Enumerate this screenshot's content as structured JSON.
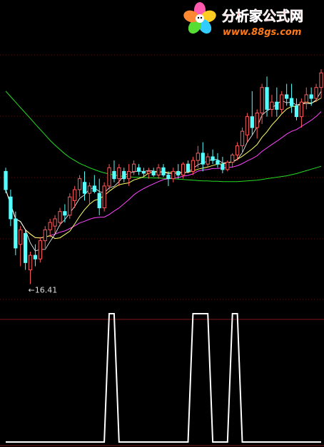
{
  "watermark": {
    "title": "分析家公式网",
    "url": "www.88gs.com",
    "colors": {
      "title": "#ff2a2a",
      "url": "#ff7a1a"
    }
  },
  "chart_data": [
    {
      "type": "candlestick",
      "ylim": [
        15.6,
        22.4
      ],
      "grid": true,
      "low_annotation": {
        "label": "←16.41",
        "value": 16.41,
        "index": 5
      },
      "colors": {
        "up": "#ff5a5a",
        "down": "#54ffff",
        "ma_short": "#ffffff",
        "ma_mid": "#ffff66",
        "ma_long": "#ff44ff",
        "ma_longest": "#22dd22"
      },
      "candles": [
        {
          "o": 19.5,
          "h": 19.6,
          "l": 18.9,
          "c": 19.0
        },
        {
          "o": 18.8,
          "h": 19.0,
          "l": 18.0,
          "c": 18.2
        },
        {
          "o": 18.2,
          "h": 18.4,
          "l": 17.2,
          "c": 17.4
        },
        {
          "o": 17.5,
          "h": 18.0,
          "l": 16.9,
          "c": 17.9
        },
        {
          "o": 17.8,
          "h": 17.9,
          "l": 16.8,
          "c": 17.0
        },
        {
          "o": 16.8,
          "h": 17.3,
          "l": 16.41,
          "c": 17.2
        },
        {
          "o": 17.2,
          "h": 17.5,
          "l": 16.9,
          "c": 17.1
        },
        {
          "o": 17.1,
          "h": 17.7,
          "l": 17.0,
          "c": 17.6
        },
        {
          "o": 17.6,
          "h": 18.0,
          "l": 17.4,
          "c": 17.9
        },
        {
          "o": 17.9,
          "h": 18.2,
          "l": 17.7,
          "c": 18.1
        },
        {
          "o": 18.0,
          "h": 18.3,
          "l": 17.8,
          "c": 18.2
        },
        {
          "o": 18.1,
          "h": 18.5,
          "l": 18.0,
          "c": 18.4
        },
        {
          "o": 18.4,
          "h": 18.6,
          "l": 18.1,
          "c": 18.3
        },
        {
          "o": 18.3,
          "h": 18.9,
          "l": 18.2,
          "c": 18.8
        },
        {
          "o": 18.7,
          "h": 19.1,
          "l": 18.5,
          "c": 19.0
        },
        {
          "o": 19.0,
          "h": 19.4,
          "l": 18.8,
          "c": 19.3
        },
        {
          "o": 19.2,
          "h": 19.5,
          "l": 18.7,
          "c": 18.9
        },
        {
          "o": 18.9,
          "h": 19.2,
          "l": 18.6,
          "c": 19.1
        },
        {
          "o": 19.1,
          "h": 19.4,
          "l": 18.9,
          "c": 18.95
        },
        {
          "o": 18.9,
          "h": 19.3,
          "l": 18.3,
          "c": 18.5
        },
        {
          "o": 18.5,
          "h": 19.2,
          "l": 18.4,
          "c": 19.1
        },
        {
          "o": 19.1,
          "h": 19.7,
          "l": 19.0,
          "c": 19.6
        },
        {
          "o": 19.5,
          "h": 19.8,
          "l": 19.2,
          "c": 19.3
        },
        {
          "o": 19.3,
          "h": 19.7,
          "l": 19.1,
          "c": 19.6
        },
        {
          "o": 19.5,
          "h": 19.6,
          "l": 19.2,
          "c": 19.3
        },
        {
          "o": 19.3,
          "h": 19.7,
          "l": 19.1,
          "c": 19.5
        },
        {
          "o": 19.5,
          "h": 19.8,
          "l": 19.4,
          "c": 19.7
        },
        {
          "o": 19.6,
          "h": 19.7,
          "l": 19.4,
          "c": 19.5
        },
        {
          "o": 19.5,
          "h": 19.6,
          "l": 19.35,
          "c": 19.45
        },
        {
          "o": 19.45,
          "h": 19.6,
          "l": 19.3,
          "c": 19.5
        },
        {
          "o": 19.5,
          "h": 19.6,
          "l": 19.35,
          "c": 19.4
        },
        {
          "o": 19.4,
          "h": 19.7,
          "l": 19.3,
          "c": 19.6
        },
        {
          "o": 19.6,
          "h": 19.7,
          "l": 19.35,
          "c": 19.4
        },
        {
          "o": 19.4,
          "h": 19.5,
          "l": 19.1,
          "c": 19.3
        },
        {
          "o": 19.3,
          "h": 19.6,
          "l": 19.2,
          "c": 19.5
        },
        {
          "o": 19.5,
          "h": 19.7,
          "l": 19.3,
          "c": 19.4
        },
        {
          "o": 19.4,
          "h": 19.75,
          "l": 19.3,
          "c": 19.7
        },
        {
          "o": 19.7,
          "h": 19.8,
          "l": 19.45,
          "c": 19.5
        },
        {
          "o": 19.5,
          "h": 19.9,
          "l": 19.4,
          "c": 19.8
        },
        {
          "o": 19.8,
          "h": 20.2,
          "l": 19.6,
          "c": 20.0
        },
        {
          "o": 20.0,
          "h": 20.3,
          "l": 19.5,
          "c": 19.7
        },
        {
          "o": 19.7,
          "h": 20.0,
          "l": 19.6,
          "c": 19.9
        },
        {
          "o": 19.9,
          "h": 20.1,
          "l": 19.7,
          "c": 19.8
        },
        {
          "o": 19.8,
          "h": 20.0,
          "l": 19.6,
          "c": 19.7
        },
        {
          "o": 19.7,
          "h": 19.9,
          "l": 19.45,
          "c": 19.55
        },
        {
          "o": 19.55,
          "h": 19.8,
          "l": 19.5,
          "c": 19.75
        },
        {
          "o": 19.75,
          "h": 20.0,
          "l": 19.6,
          "c": 19.95
        },
        {
          "o": 19.95,
          "h": 20.3,
          "l": 19.8,
          "c": 20.2
        },
        {
          "o": 20.2,
          "h": 20.7,
          "l": 20.0,
          "c": 20.6
        },
        {
          "o": 20.5,
          "h": 21.1,
          "l": 20.3,
          "c": 21.0
        },
        {
          "o": 21.0,
          "h": 21.7,
          "l": 20.5,
          "c": 20.7
        },
        {
          "o": 20.7,
          "h": 21.2,
          "l": 20.4,
          "c": 21.1
        },
        {
          "o": 21.1,
          "h": 21.9,
          "l": 20.8,
          "c": 21.8
        },
        {
          "o": 21.8,
          "h": 22.1,
          "l": 21.0,
          "c": 21.2
        },
        {
          "o": 21.2,
          "h": 21.6,
          "l": 21.0,
          "c": 21.4
        },
        {
          "o": 21.4,
          "h": 21.8,
          "l": 21.0,
          "c": 21.2
        },
        {
          "o": 21.2,
          "h": 21.7,
          "l": 21.1,
          "c": 21.6
        },
        {
          "o": 21.6,
          "h": 21.9,
          "l": 21.3,
          "c": 21.5
        },
        {
          "o": 21.5,
          "h": 21.9,
          "l": 21.1,
          "c": 21.3
        },
        {
          "o": 21.3,
          "h": 21.5,
          "l": 20.9,
          "c": 21.0
        },
        {
          "o": 21.0,
          "h": 21.5,
          "l": 20.7,
          "c": 21.4
        },
        {
          "o": 21.4,
          "h": 21.8,
          "l": 21.2,
          "c": 21.6
        },
        {
          "o": 21.6,
          "h": 21.8,
          "l": 21.3,
          "c": 21.5
        },
        {
          "o": 21.5,
          "h": 21.9,
          "l": 21.4,
          "c": 21.8
        },
        {
          "o": 21.8,
          "h": 22.3,
          "l": 21.5,
          "c": 22.2
        }
      ],
      "ma_longest": [
        21.7,
        21.55,
        21.4,
        21.25,
        21.1,
        20.95,
        20.8,
        20.65,
        20.5,
        20.35,
        20.22,
        20.1,
        19.98,
        19.88,
        19.8,
        19.72,
        19.66,
        19.6,
        19.55,
        19.5,
        19.46,
        19.43,
        19.4,
        19.38,
        19.36,
        19.35,
        19.34,
        19.34,
        19.33,
        19.33,
        19.32,
        19.32,
        19.31,
        19.3,
        19.3,
        19.29,
        19.28,
        19.27,
        19.26,
        19.25,
        19.24,
        19.24,
        19.23,
        19.23,
        19.22,
        19.22,
        19.22,
        19.22,
        19.23,
        19.24,
        19.25,
        19.26,
        19.28,
        19.3,
        19.32,
        19.34,
        19.36,
        19.38,
        19.41,
        19.44,
        19.48,
        19.52,
        19.56,
        19.6,
        19.64
      ]
    },
    {
      "type": "line",
      "ylim": [
        0,
        1
      ],
      "color": "#ffffff",
      "values": [
        0,
        0,
        0,
        0,
        0,
        0,
        0,
        0,
        0,
        0,
        0,
        0,
        0,
        0,
        0,
        0,
        0,
        0,
        0,
        0,
        0,
        1,
        1,
        0,
        0,
        0,
        0,
        0,
        0,
        0,
        0,
        0,
        0,
        0,
        0,
        0,
        0,
        0,
        1,
        1,
        1,
        1,
        0,
        0,
        0,
        0,
        1,
        1,
        0,
        0,
        0,
        0,
        0,
        0,
        0,
        0,
        0,
        0,
        0,
        0,
        0,
        0,
        0,
        0,
        0
      ]
    }
  ]
}
